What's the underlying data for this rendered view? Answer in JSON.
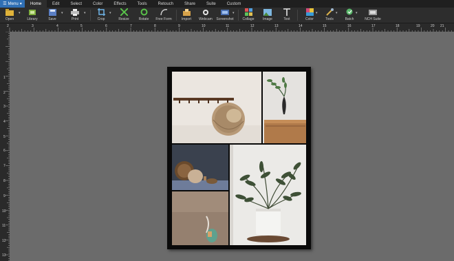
{
  "menu": {
    "label": "Menu"
  },
  "tabs": [
    "Home",
    "Edit",
    "Select",
    "Color",
    "Effects",
    "Tools",
    "Retouch",
    "Share",
    "Suite",
    "Custom"
  ],
  "toolbar": {
    "open": "Open",
    "library": "Library",
    "save": "Save",
    "print": "Print",
    "crop": "Crop",
    "resize": "Resize",
    "rotate": "Rotate",
    "free_form": "Free Form",
    "import": "Import",
    "webcam": "Webcam",
    "screenshot": "Screenshot",
    "collage": "Collage",
    "image": "Image",
    "text": "Text",
    "color": "Color",
    "tools": "Tools",
    "batch": "Batch",
    "nch_suite": "NCH Suite"
  },
  "ruler_top": [
    "2",
    "3",
    "4",
    "5",
    "6",
    "7",
    "8",
    "9",
    "10",
    "11",
    "12",
    "13",
    "14",
    "15",
    "16",
    "17",
    "18",
    "19",
    "20",
    "21"
  ],
  "ruler_left": [
    "1",
    "2",
    "3",
    "4",
    "5",
    "6",
    "7",
    "8",
    "9",
    "10",
    "11",
    "12",
    "13",
    "14"
  ],
  "colors": {
    "accent": "#2f6fb4",
    "toolbar_bg": "#2d2d2d",
    "canvas_bg": "#6b6b6b"
  }
}
